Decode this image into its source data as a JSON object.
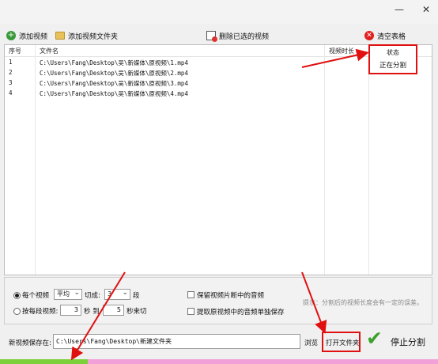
{
  "window": {
    "minimize_glyph": "—",
    "close_glyph": "✕"
  },
  "toolbar": {
    "add_video": "添加视频",
    "add_video_folder": "添加视频文件夹",
    "delete_selected": "删除已选的视频",
    "clear_table": "清空表格"
  },
  "table": {
    "headers": {
      "index": "序号",
      "filename": "文件名",
      "duration": "视频时长",
      "status": "状态"
    },
    "rows": [
      {
        "index": "1",
        "filename": "C:\\Users\\Fang\\Desktop\\吴\\新媒体\\原视频\\1.mp4"
      },
      {
        "index": "2",
        "filename": "C:\\Users\\Fang\\Desktop\\吴\\新媒体\\原视频\\2.mp4"
      },
      {
        "index": "3",
        "filename": "C:\\Users\\Fang\\Desktop\\吴\\新媒体\\原视频\\3.mp4"
      },
      {
        "index": "4",
        "filename": "C:\\Users\\Fang\\Desktop\\吴\\新媒体\\原视频\\4.mp4"
      }
    ],
    "status_value": "正在分割"
  },
  "settings": {
    "mode_each_video": "每个视频",
    "split_type": "平均",
    "cut_label": "切成:",
    "segments": "3",
    "segments_unit": "段",
    "mode_per_segment": "按每段视频:",
    "from_seconds": "3",
    "sec_label": "秒 到",
    "to_seconds": "5",
    "cut_unit": "秒来切",
    "keep_audio": "保留视频片断中的音频",
    "extract_audio": "提取原视频中的音频单独保存",
    "tip": "提示：分割后的视频长度会有一定的误差。"
  },
  "save": {
    "label": "新视频保存在:",
    "path": "C:\\Users\\Fang\\Desktop\\新建文件夹",
    "browse": "浏览",
    "open_folder": "打开文件夹",
    "stop": "停止分割"
  },
  "progress": {
    "fraction": 0.2
  },
  "colors": {
    "accent_red": "#e01010",
    "progress_green": "#7cd13a",
    "progress_pink": "#f2a0d8",
    "check_green": "#3aa12a"
  }
}
